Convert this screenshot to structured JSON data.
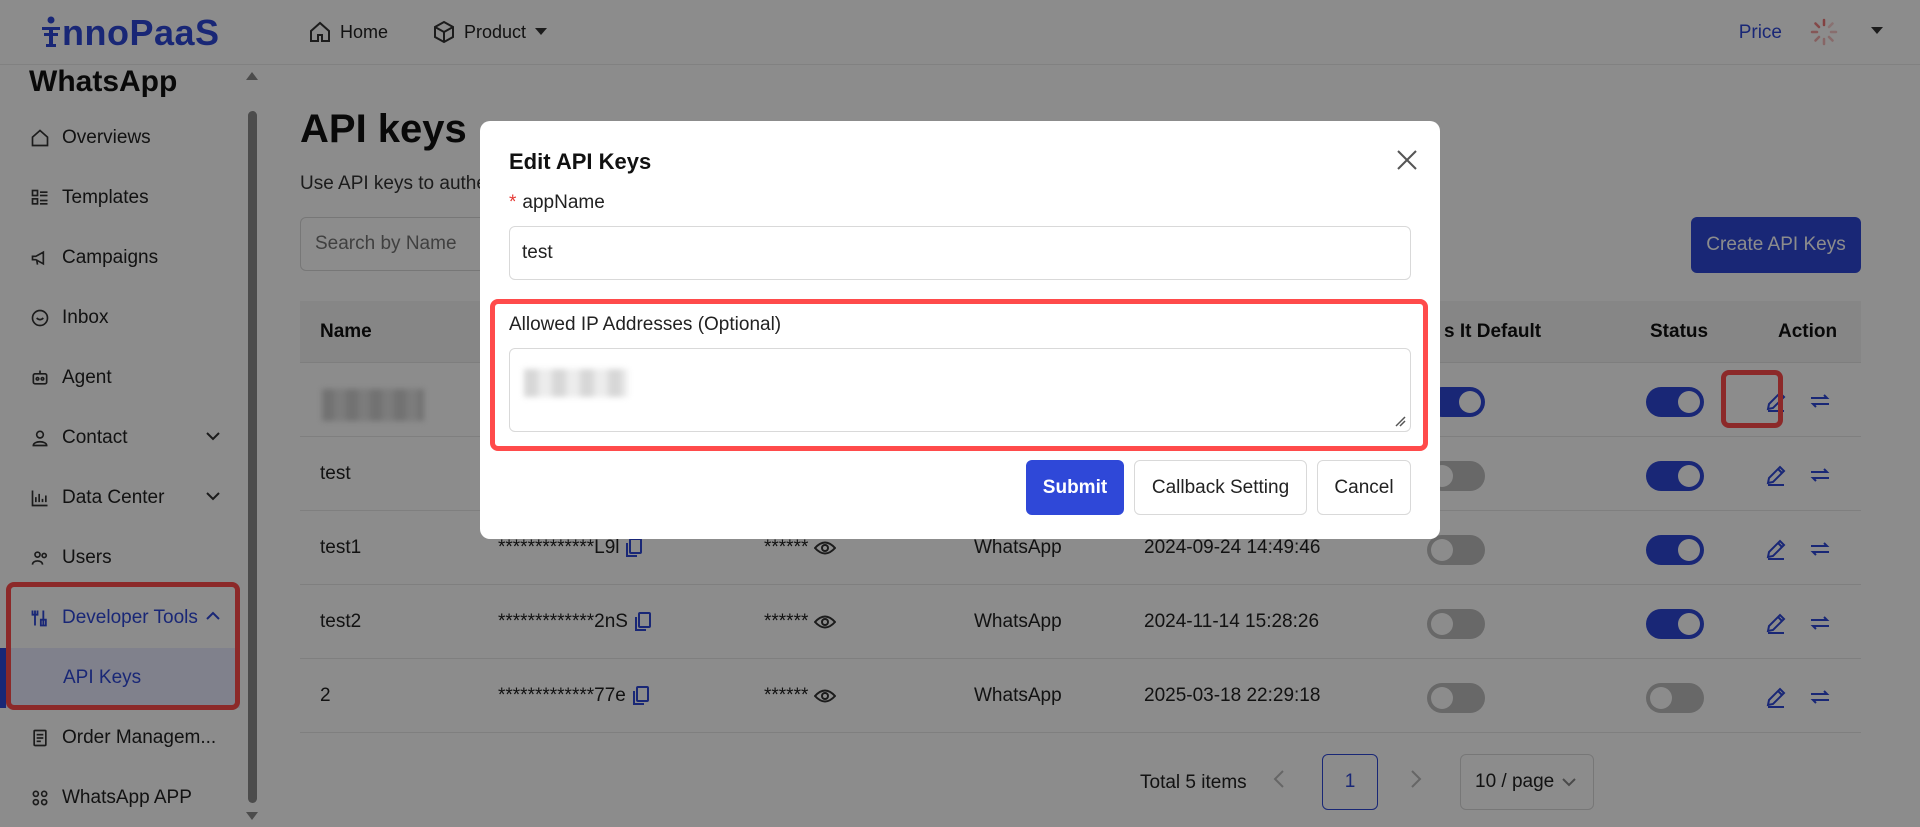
{
  "brand": {
    "logo_text": "nnoPaaS",
    "color": "#2f48d8"
  },
  "topnav": {
    "home": "Home",
    "product": "Product",
    "price": "Price"
  },
  "sidebar": {
    "title": "WhatsApp",
    "items": [
      {
        "label": "Overviews",
        "icon": "home-icon"
      },
      {
        "label": "Templates",
        "icon": "list-icon"
      },
      {
        "label": "Campaigns",
        "icon": "megaphone-icon"
      },
      {
        "label": "Inbox",
        "icon": "chat-icon"
      },
      {
        "label": "Agent",
        "icon": "robot-icon"
      },
      {
        "label": "Contact",
        "icon": "user-icon"
      },
      {
        "label": "Data Center",
        "icon": "chart-icon"
      },
      {
        "label": "Users",
        "icon": "users-icon"
      },
      {
        "label": "Developer Tools",
        "icon": "tools-icon"
      },
      {
        "label": "API Keys",
        "icon": ""
      },
      {
        "label": "Order Managem...",
        "icon": "document-icon"
      },
      {
        "label": "WhatsApp APP",
        "icon": "apps-icon"
      }
    ]
  },
  "main": {
    "title": "API keys",
    "description": "Use API keys to authe",
    "search_placeholder": "Search by Name",
    "create_button": "Create API Keys",
    "columns": {
      "name": "Name",
      "is_default": "s It Default",
      "status": "Status",
      "action": "Action"
    },
    "rows": [
      {
        "name": "",
        "key": "",
        "secret": "",
        "channel": "",
        "created": "",
        "is_default": true,
        "status": true
      },
      {
        "name": "test",
        "key": "",
        "secret": "",
        "channel": "",
        "created": "",
        "is_default": false,
        "status": true
      },
      {
        "name": "test1",
        "key": "*************L9l",
        "secret": "******",
        "channel": "WhatsApp",
        "created": "2024-09-24 14:49:46",
        "is_default": false,
        "status": true
      },
      {
        "name": "test2",
        "key": "*************2nS",
        "secret": "******",
        "channel": "WhatsApp",
        "created": "2024-11-14 15:28:26",
        "is_default": false,
        "status": true
      },
      {
        "name": "2",
        "key": "*************77e",
        "secret": "******",
        "channel": "WhatsApp",
        "created": "2025-03-18 22:29:18",
        "is_default": false,
        "status": false
      }
    ],
    "pagination": {
      "total": "Total 5 items",
      "page": "1",
      "page_size": "10 / page"
    }
  },
  "modal": {
    "title": "Edit API Keys",
    "app_name_label": "appName",
    "required_mark": "*",
    "app_name_value": "test",
    "allowed_ip_label": "Allowed IP Addresses (Optional)",
    "submit": "Submit",
    "callback": "Callback Setting",
    "cancel": "Cancel"
  }
}
